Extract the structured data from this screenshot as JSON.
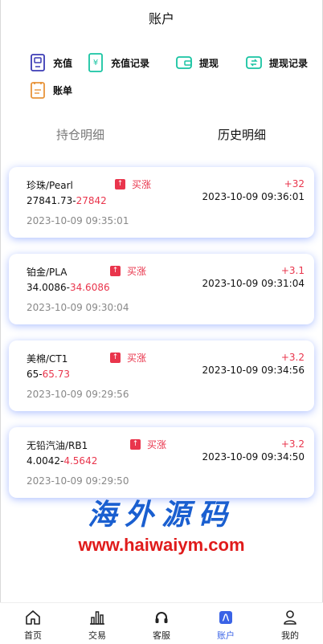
{
  "header": {
    "title": "账户"
  },
  "actions": [
    {
      "label": "充值",
      "icon": "recharge-icon"
    },
    {
      "label": "充值记录",
      "icon": "recharge-record-icon"
    },
    {
      "label": "提现",
      "icon": "wallet-icon"
    },
    {
      "label": "提现记录",
      "icon": "withdraw-record-icon"
    },
    {
      "label": "账单",
      "icon": "bill-icon"
    }
  ],
  "tabs": {
    "holdings": "持仓明细",
    "history": "历史明细"
  },
  "orders": [
    {
      "pair": "珍珠/Pearl",
      "direction": "买涨",
      "profit": "+32",
      "open_price": "27841.73",
      "close_price": "27842",
      "sep": "-",
      "close_time": "2023-10-09 09:36:01",
      "open_time": "2023-10-09 09:35:01"
    },
    {
      "pair": "铂金/PLA",
      "direction": "买涨",
      "profit": "+3.1",
      "open_price": "34.0086",
      "close_price": "34.6086",
      "sep": "-",
      "close_time": "2023-10-09 09:31:04",
      "open_time": "2023-10-09 09:30:04"
    },
    {
      "pair": "美棉/CT1",
      "direction": "买涨",
      "profit": "+3.2",
      "open_price": "65",
      "close_price": "65.73",
      "sep": "-",
      "close_time": "2023-10-09 09:34:56",
      "open_time": "2023-10-09 09:29:56"
    },
    {
      "pair": "无铅汽油/RB1",
      "direction": "买涨",
      "profit": "+3.2",
      "open_price": "4.0042",
      "close_price": "4.5642",
      "sep": "-",
      "close_time": "2023-10-09 09:34:50",
      "open_time": "2023-10-09 09:29:50"
    }
  ],
  "watermark": {
    "brand": "海外源码",
    "url": "www.haiwaiym.com"
  },
  "tabbar": [
    {
      "label": "首页",
      "icon": "home-icon"
    },
    {
      "label": "交易",
      "icon": "chart-icon"
    },
    {
      "label": "客服",
      "icon": "headset-icon"
    },
    {
      "label": "账户",
      "icon": "account-icon"
    },
    {
      "label": "我的",
      "icon": "user-icon"
    }
  ],
  "colors": {
    "accent": "#3a63e6",
    "rise": "#e9354c",
    "card_glow": "#5078ff"
  }
}
